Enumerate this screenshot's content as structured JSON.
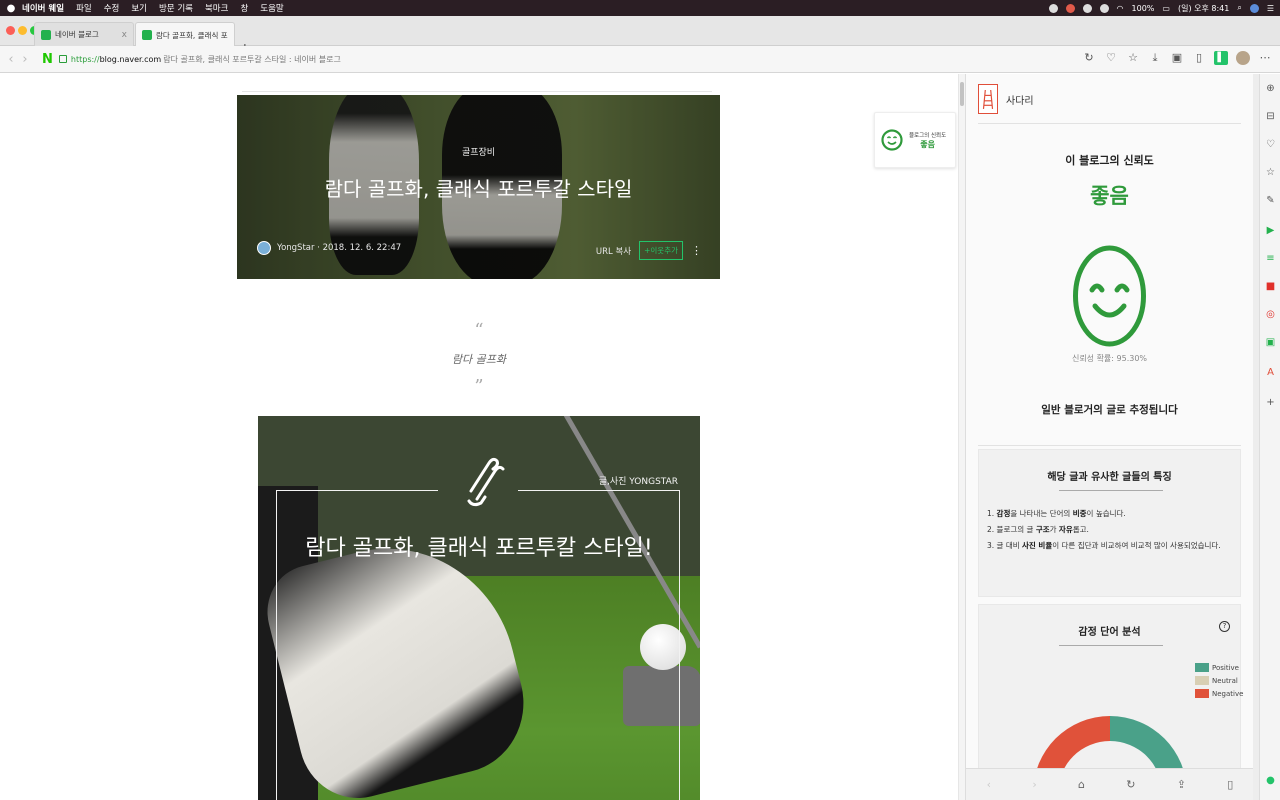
{
  "menubar": {
    "app": "네이버 웨일",
    "items": [
      "파일",
      "수정",
      "보기",
      "방문 기록",
      "북마크",
      "창",
      "도움말"
    ],
    "battery": "100%",
    "clock": "(일) 오후 8:41"
  },
  "tabs": [
    {
      "label": "네이버 블로그",
      "close": "x"
    },
    {
      "label": "람다 골프화, 클래식 포르투갈",
      "close": "x"
    }
  ],
  "address": {
    "protocol": "https://",
    "domain": "blog.naver.com",
    "rest": "람다 골프화, 클래식 포르투갈 스타일 : 네이버 블로그"
  },
  "post": {
    "category": "골프장비",
    "title": "람다 골프화, 클래식 포르투갈 스타일",
    "author_date": "YongStar · 2018. 12. 6. 22:47",
    "url_copy": "URL 복사",
    "neighbor_add": "+이웃추가",
    "quote": "람다 골프화",
    "photo_credit": "글,사진 YONGSTAR",
    "photo_title": "람다 골프화, 클래식 포르투칼 스타일!"
  },
  "float_widget": {
    "label": "블로그의 신뢰도",
    "value": "좋음"
  },
  "sidepanel": {
    "name": "사다리",
    "trust_title": "이 블로그의 신뢰도",
    "trust_value": "좋음",
    "probability": "신뢰성 확률: 95.30%",
    "verdict": "일반 블로거의 글로 추정됩니다",
    "features": {
      "title": "해당 글과 유사한 글들의 특징",
      "items": [
        {
          "pre": "1. ",
          "bold": "감정",
          "mid": "을 나타내는 단어의 ",
          "bold2": "비중",
          "post": "이 높습니다."
        },
        {
          "pre": "2. 블로그의 글 ",
          "bold": "구조",
          "mid": "가 ",
          "bold2": "자유",
          "post": "롭고."
        },
        {
          "pre": "3. 글 대비 ",
          "bold": "사진 비율",
          "mid": "이 다른 집단과 비교하여 비교적 많이 사용되었습니다.",
          "bold2": "",
          "post": ""
        }
      ]
    },
    "sentiment": {
      "title": "감정 단어 분석",
      "help": "?",
      "legend": [
        {
          "label": "Positive",
          "color": "#4aa189"
        },
        {
          "label": "Neutral",
          "color": "#d8cfb4"
        },
        {
          "label": "Negative",
          "color": "#e0523a"
        }
      ]
    }
  },
  "colors": {
    "accent_green": "#2f9a3b",
    "naver_green": "#1ec800",
    "positive": "#4aa189",
    "negative": "#e0523a"
  }
}
